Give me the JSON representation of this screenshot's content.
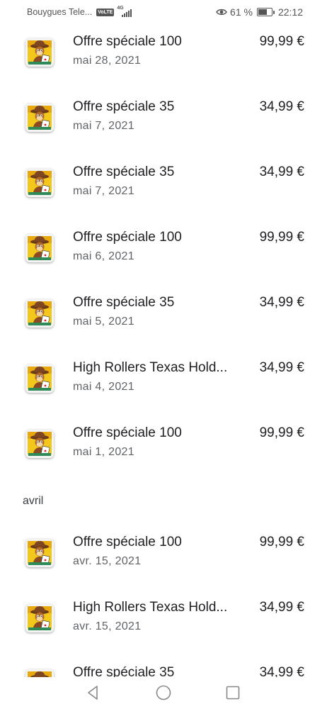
{
  "status_bar": {
    "carrier": "Bouygues Tele...",
    "volte": "VoLTE",
    "network": "4G",
    "battery_percent": "61 %",
    "battery_level": 0.61,
    "time": "22:12"
  },
  "purchases": [
    {
      "title": "Offre spéciale 100",
      "date": "mai 28, 2021",
      "price": "99,99 €"
    },
    {
      "title": "Offre spéciale 35",
      "date": "mai 7, 2021",
      "price": "34,99 €"
    },
    {
      "title": "Offre spéciale 35",
      "date": "mai 7, 2021",
      "price": "34,99 €"
    },
    {
      "title": "Offre spéciale 100",
      "date": "mai 6, 2021",
      "price": "99,99 €"
    },
    {
      "title": "Offre spéciale 35",
      "date": "mai 5, 2021",
      "price": "34,99 €"
    },
    {
      "title": "High Rollers Texas Hold...",
      "date": "mai 4, 2021",
      "price": "34,99 €"
    },
    {
      "title": "Offre spéciale 100",
      "date": "mai 1, 2021",
      "price": "99,99 €"
    }
  ],
  "april_section": {
    "header": "avril",
    "purchases": [
      {
        "title": "Offre spéciale 100",
        "date": "avr. 15, 2021",
        "price": "99,99 €"
      },
      {
        "title": "High Rollers Texas Hold...",
        "date": "avr. 15, 2021",
        "price": "34,99 €"
      },
      {
        "title": "Offre spéciale 35",
        "date": "",
        "price": "34,99 €"
      }
    ]
  },
  "app_icon": "high-rollers-app-icon",
  "nav_icons": [
    "back-icon",
    "home-icon",
    "recents-icon"
  ]
}
